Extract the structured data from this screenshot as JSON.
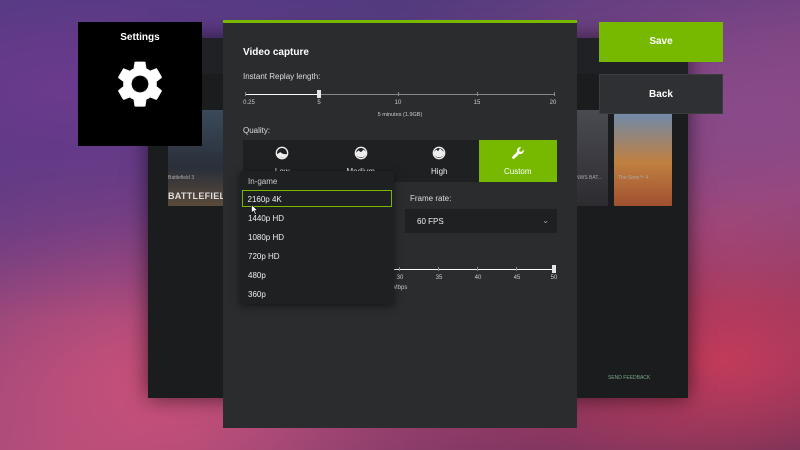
{
  "background_app": {
    "game_caption_left": "Battlefield 3",
    "game_logo_left": "BATTLEFIELD 3",
    "game_caption_mid": "NWS BAT...",
    "game_caption_right": "The Sims™ 4",
    "feedback_label": "SEND FEEDBACK"
  },
  "settings_tile": {
    "title": "Settings",
    "icon": "gear-icon"
  },
  "panel": {
    "title": "Video capture",
    "replay": {
      "label": "Instant Replay length:",
      "ticks": [
        "0.25",
        "5",
        "10",
        "15",
        "20"
      ],
      "value": 5,
      "value_text": "5 minutes (1.9GB)"
    },
    "quality": {
      "label": "Quality:",
      "options": [
        {
          "label": "Low",
          "icon": "low-quality-icon"
        },
        {
          "label": "Medium",
          "icon": "medium-quality-icon"
        },
        {
          "label": "High",
          "icon": "high-quality-icon"
        },
        {
          "label": "Custom",
          "icon": "wrench-icon"
        }
      ],
      "selected": "Custom"
    },
    "frame_rate": {
      "label": "Frame rate:",
      "value": "60 FPS"
    },
    "bitrate": {
      "ticks": [
        "30",
        "35",
        "40",
        "45",
        "50"
      ],
      "unit_text": "Mbps",
      "value": 50
    },
    "resolution_dropdown": {
      "header": "In-game",
      "options": [
        "2160p 4K",
        "1440p HD",
        "1080p HD",
        "720p HD",
        "480p",
        "360p"
      ],
      "selected": "2160p 4K"
    }
  },
  "actions": {
    "save_label": "Save",
    "back_label": "Back"
  },
  "colors": {
    "accent": "#76b900",
    "panel_bg": "#2b2c2e",
    "control_bg": "#1f2022"
  }
}
